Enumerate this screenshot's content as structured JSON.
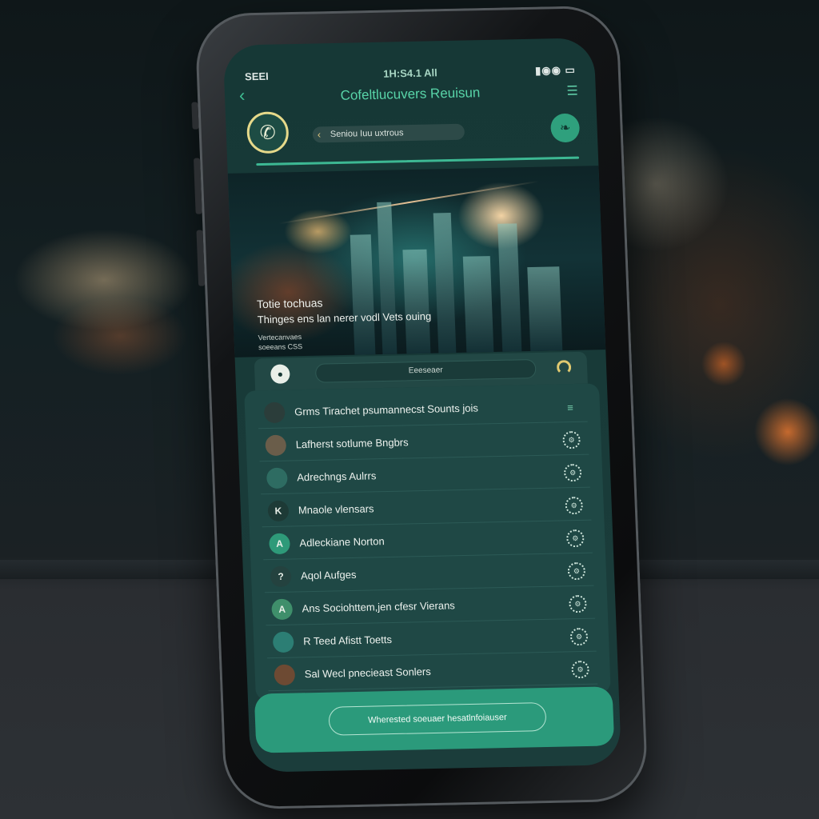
{
  "status_bar": {
    "carrier": "SEEI",
    "time": "1H:S4.1 All",
    "icons": "▮◉◉ ▭"
  },
  "header": {
    "back_icon": "chevron-left-icon",
    "title": "Cofeltlucuvers Reuisun",
    "menu_icon": "menu-icon"
  },
  "call_row": {
    "call_icon": "phone-icon",
    "search_text": "Seniou Iuu uxtrous",
    "leaf_icon": "leaf-icon"
  },
  "hero": {
    "title": "Totie tochuas",
    "subtitle": "Thinges ens lan nerer vodl Vets ouing",
    "meta": "Vertecanvaes",
    "tag": "soeeans CSS"
  },
  "toolbar": {
    "left_icon": "shield-icon",
    "pill_label": "Eeeseaer",
    "right_icon": "moon-icon"
  },
  "list": {
    "items": [
      {
        "label": "Grms Tirachet psumannecst Sounts jois",
        "avatar_color": "#2b3d3a",
        "action": "menu-icon"
      },
      {
        "label": "Lafherst sotlume Bngbrs",
        "avatar_color": "#6a5d4a",
        "action": "settings-icon"
      },
      {
        "label": "Adrechngs Aulrrs",
        "avatar_color": "#2e6c62",
        "action": "settings-icon"
      },
      {
        "label": "Mnaole vlensars",
        "avatar_color": "#1d3a36",
        "avatar_text": "K",
        "action": "settings-icon"
      },
      {
        "label": "Adleckiane Norton",
        "avatar_color": "#2e9a79",
        "avatar_text": "A",
        "action": "settings-icon"
      },
      {
        "label": "Aqol Aufges",
        "avatar_color": "#24423f",
        "avatar_text": "?",
        "action": "settings-icon"
      },
      {
        "label": "Ans Sociohttem,jen cfesr Vierans",
        "avatar_color": "#3f8f6b",
        "avatar_text": "A",
        "action": "settings-icon"
      },
      {
        "label": "R Teed Afistt Toetts",
        "avatar_color": "#2c7e74",
        "action": "settings-icon"
      },
      {
        "label": "Sal Wecl pnecieast Sonlers",
        "avatar_color": "#6d4a33",
        "action": "settings-icon"
      }
    ]
  },
  "cta": {
    "label": "Wherested soeuaer hesatlnfoiauser"
  }
}
